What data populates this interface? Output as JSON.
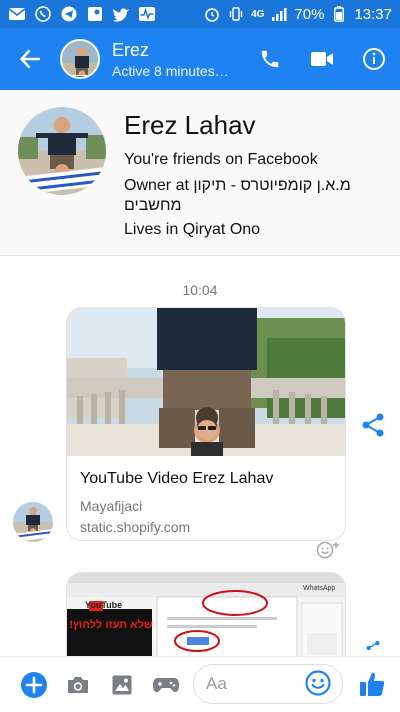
{
  "status_bar": {
    "left_icons": [
      "mail-icon",
      "whatsapp-icon",
      "telegram-icon",
      "maps-icon",
      "twitter-icon",
      "activity-icon"
    ],
    "signal_label": "4G",
    "battery": "70%",
    "time": "13:37"
  },
  "header": {
    "name": "Erez",
    "subtitle": "Active 8 minutes…",
    "actions": [
      "phone-icon",
      "video-icon",
      "info-icon"
    ],
    "color": "#1e82f0"
  },
  "profile": {
    "name": "Erez Lahav",
    "friends": "You're friends on Facebook",
    "work": "Owner at מ.א.ן קומפיוטרס - תיקון מחשבים",
    "lives": "Lives in Qiryat Ono"
  },
  "conversation": {
    "time": "10:04",
    "link_card": {
      "title": "YouTube Video Erez Lahav",
      "source": "Mayafijaci",
      "domain": "static.shopify.com"
    },
    "second_card": {
      "youtube_label": "YouTube",
      "hebrew_banner": "שלא תעזו ללחוץ!",
      "whatsapp_label": "WhatsApp"
    }
  },
  "composer": {
    "placeholder": "Aa",
    "accent": "#1e82f0"
  }
}
